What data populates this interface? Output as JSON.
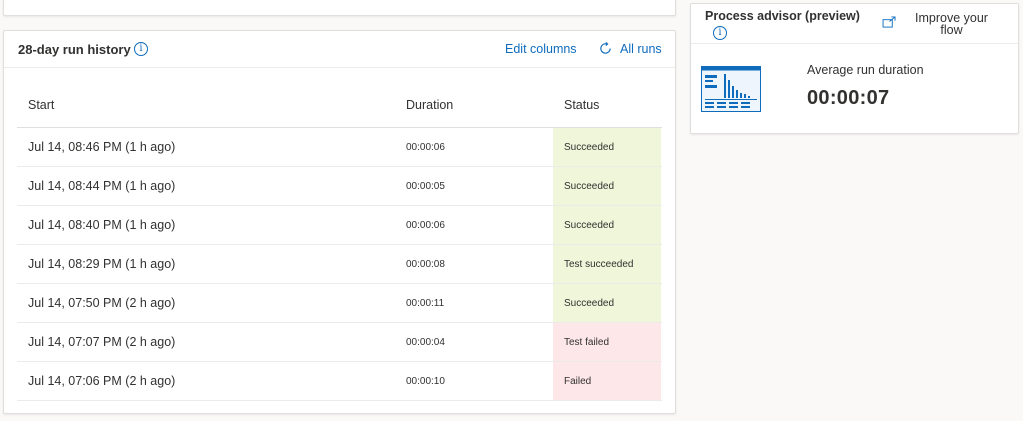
{
  "run_history": {
    "title": "28-day run history",
    "info_icon": "info-icon",
    "edit_columns": "Edit columns",
    "refresh_icon": "refresh-icon",
    "all_runs": "All runs",
    "columns": {
      "start": "Start",
      "duration": "Duration",
      "status": "Status"
    },
    "rows": [
      {
        "start": "Jul 14, 08:46 PM (1 h ago)",
        "duration": "00:00:06",
        "status": "Succeeded",
        "state": "ok"
      },
      {
        "start": "Jul 14, 08:44 PM (1 h ago)",
        "duration": "00:00:05",
        "status": "Succeeded",
        "state": "ok"
      },
      {
        "start": "Jul 14, 08:40 PM (1 h ago)",
        "duration": "00:00:06",
        "status": "Succeeded",
        "state": "ok"
      },
      {
        "start": "Jul 14, 08:29 PM (1 h ago)",
        "duration": "00:00:08",
        "status": "Test succeeded",
        "state": "ok"
      },
      {
        "start": "Jul 14, 07:50 PM (2 h ago)",
        "duration": "00:00:11",
        "status": "Succeeded",
        "state": "ok"
      },
      {
        "start": "Jul 14, 07:07 PM (2 h ago)",
        "duration": "00:00:04",
        "status": "Test failed",
        "state": "bad"
      },
      {
        "start": "Jul 14, 07:06 PM (2 h ago)",
        "duration": "00:00:10",
        "status": "Failed",
        "state": "bad"
      }
    ]
  },
  "process_advisor": {
    "title": "Process advisor (preview)",
    "info_icon": "info-icon",
    "improve_icon": "external-link-icon",
    "improve_label": "Improve your flow",
    "avg_label": "Average run duration",
    "avg_value": "00:00:07"
  },
  "colors": {
    "accent": "#0f6cbd",
    "success_bg": "#eff6d9",
    "failed_bg": "#fde7e9"
  }
}
